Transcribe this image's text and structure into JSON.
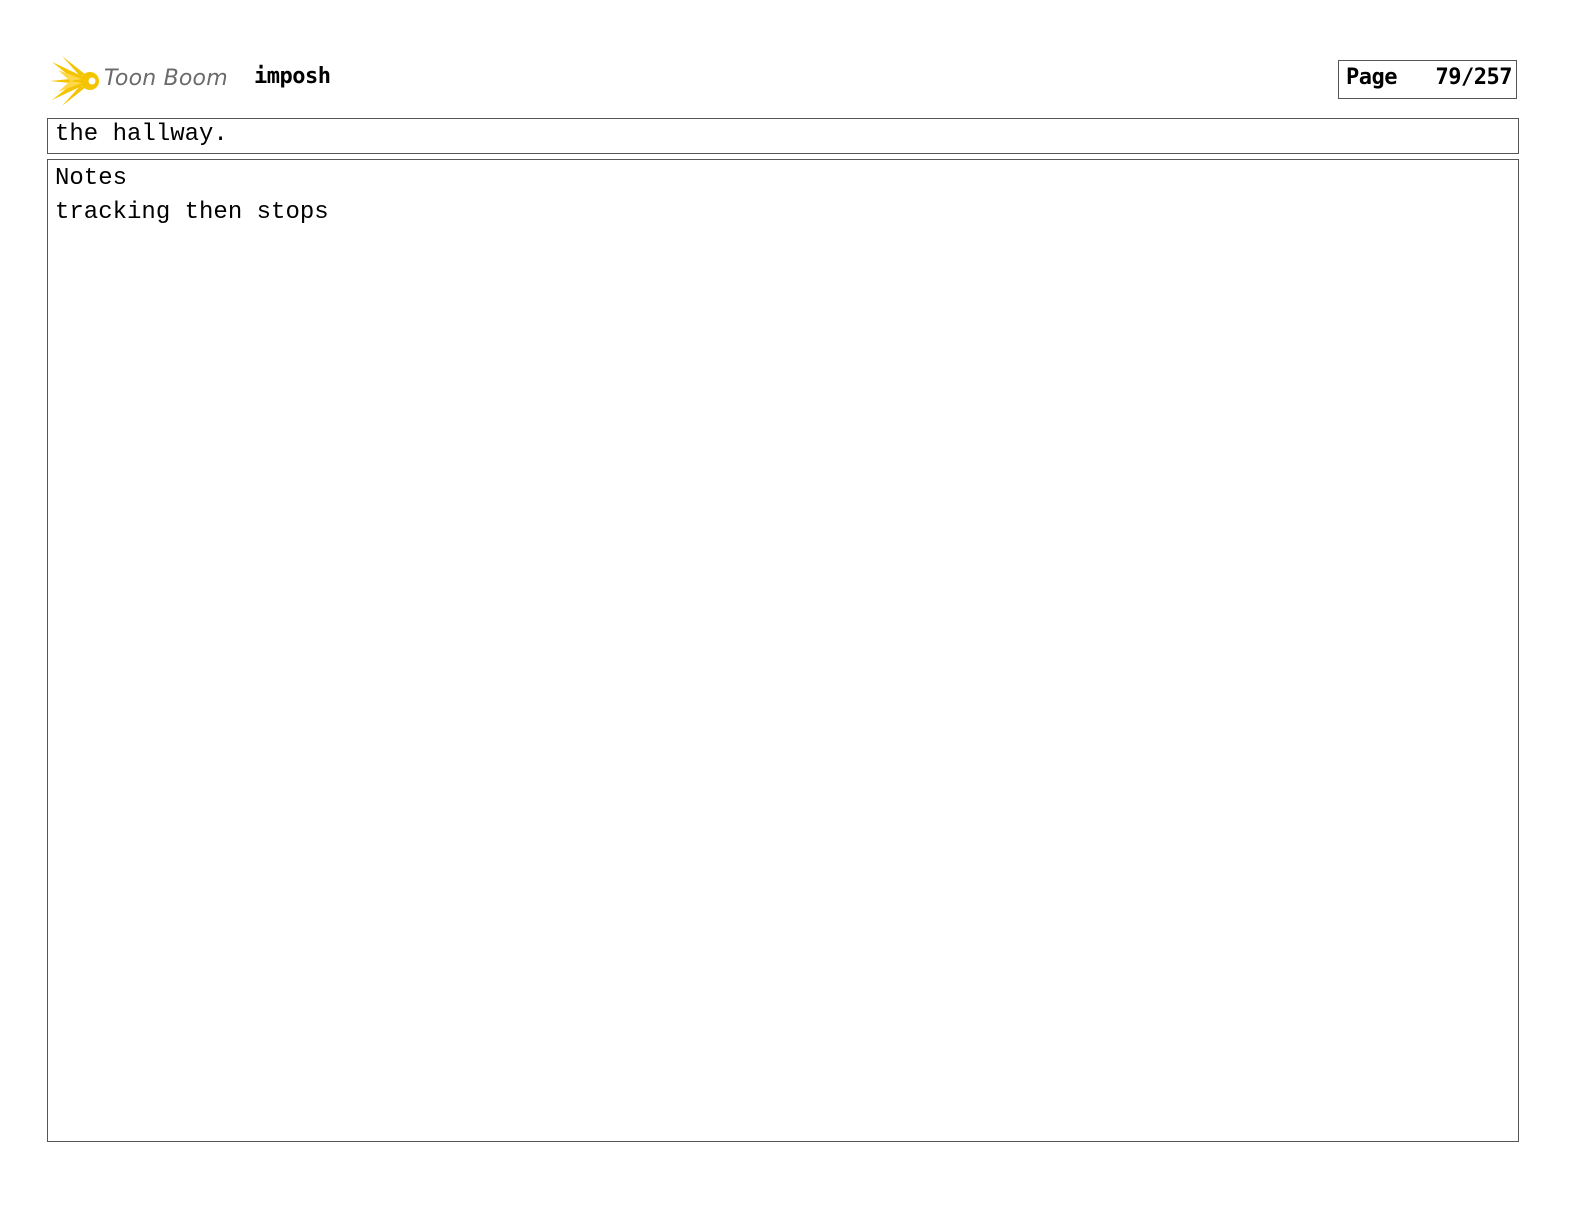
{
  "header": {
    "brand": "Toon Boom",
    "project": "imposh",
    "page_label": "Page",
    "page_number": "79/257",
    "logo_color": "#f5c400"
  },
  "panel": {
    "dialogue": "the hallway.",
    "notes_label": "Notes",
    "notes_text": "tracking then stops"
  }
}
